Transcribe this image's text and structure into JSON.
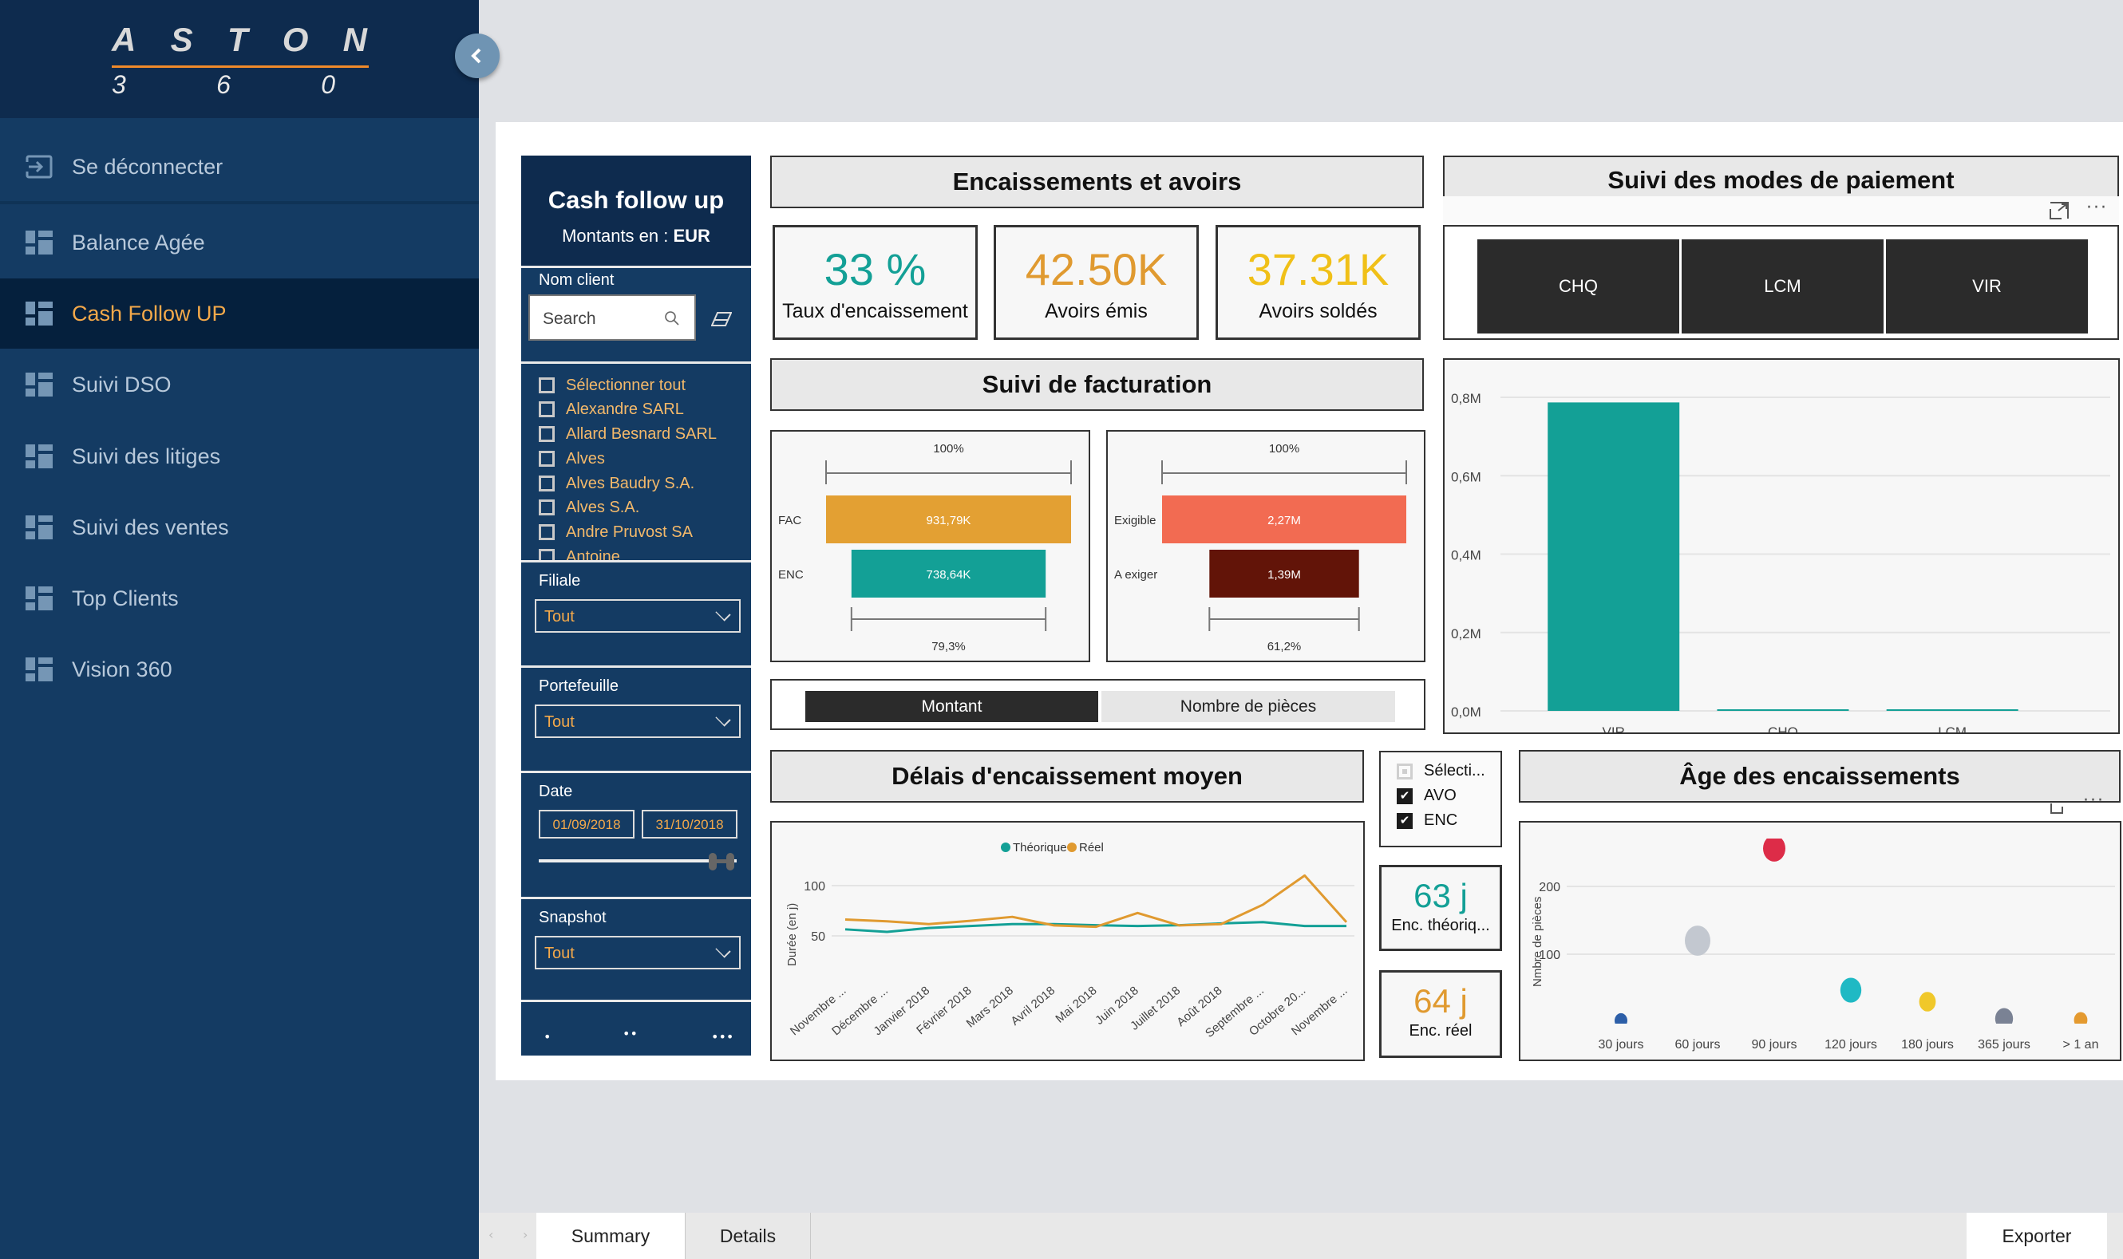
{
  "logo": {
    "letters": [
      "A",
      "S",
      "T",
      "O",
      "N"
    ],
    "numbers": [
      "3",
      "6",
      "0"
    ]
  },
  "sidebar": {
    "items": [
      {
        "label": "Se déconnecter",
        "icon": "logout-icon",
        "active": false
      },
      {
        "label": "Balance Agée",
        "icon": "dashboard-icon",
        "active": false
      },
      {
        "label": "Cash Follow UP",
        "icon": "dashboard-icon",
        "active": true
      },
      {
        "label": "Suivi DSO",
        "icon": "dashboard-icon",
        "active": false
      },
      {
        "label": "Suivi des litiges",
        "icon": "dashboard-icon",
        "active": false
      },
      {
        "label": "Suivi des ventes",
        "icon": "dashboard-icon",
        "active": false
      },
      {
        "label": "Top Clients",
        "icon": "dashboard-icon",
        "active": false
      },
      {
        "label": "Vision 360",
        "icon": "dashboard-icon",
        "active": false
      }
    ],
    "collapse_icon": "chevron-left-icon"
  },
  "slicer_panel": {
    "title": "Cash follow up",
    "subtitle_prefix": "Montants en : ",
    "currency": "EUR",
    "client": {
      "label": "Nom client",
      "search_placeholder": "Search",
      "items": [
        "Sélectionner tout",
        "Alexandre SARL",
        "Allard Besnard SARL",
        "Alves",
        "Alves Baudry S.A.",
        "Alves S.A.",
        "Andre Pruvost SA",
        "Antoine"
      ]
    },
    "filiale": {
      "label": "Filiale",
      "value": "Tout"
    },
    "portefeuille": {
      "label": "Portefeuille",
      "value": "Tout"
    },
    "date": {
      "label": "Date",
      "from": "01/09/2018",
      "to": "31/10/2018"
    },
    "snapshot": {
      "label": "Snapshot",
      "value": "Tout"
    },
    "pager": [
      "•",
      "••",
      "•••"
    ]
  },
  "encaissements": {
    "title": "Encaissements et avoirs",
    "kpis": [
      {
        "value": "33 %",
        "label": "Taux d'encaissement",
        "color": "#13a096"
      },
      {
        "value": "42.50K",
        "label": "Avoirs émis",
        "color": "#e09a30"
      },
      {
        "value": "37.31K",
        "label": "Avoirs soldés",
        "color": "#f0c018"
      }
    ]
  },
  "facturation": {
    "title": "Suivi de facturation",
    "toggle": {
      "options": [
        "Montant",
        "Nombre de pièces"
      ],
      "selected": "Montant"
    }
  },
  "modes": {
    "title": "Suivi des modes de paiement",
    "buttons": [
      "CHQ",
      "LCM",
      "VIR"
    ]
  },
  "delais": {
    "title": "Délais d'encaissement moyen"
  },
  "type_slicer": {
    "items": [
      {
        "label": "Sélecti...",
        "state": "partial"
      },
      {
        "label": "AVO",
        "state": "checked"
      },
      {
        "label": "ENC",
        "state": "checked"
      }
    ]
  },
  "cards": [
    {
      "value": "63 j",
      "label": "Enc. théoriq...",
      "color": "#13a096"
    },
    {
      "value": "64 j",
      "label": "Enc. réel",
      "color": "#e09a30"
    }
  ],
  "age": {
    "title": "Âge des encaissements"
  },
  "chart_data": [
    {
      "type": "funnel",
      "name": "facturation-funnel-fac-enc",
      "categories": [
        "FAC",
        "ENC"
      ],
      "values": [
        931.79,
        738.64
      ],
      "value_labels": [
        "931,79K",
        "738,64K"
      ],
      "top_label": "100%",
      "bottom_label": "79,3%",
      "colors": [
        "#e3a033",
        "#13a096"
      ]
    },
    {
      "type": "funnel",
      "name": "facturation-funnel-exigible",
      "categories": [
        "Exigible",
        "A exiger"
      ],
      "values": [
        2.27,
        1.39
      ],
      "value_labels": [
        "2,27M",
        "1,39M"
      ],
      "top_label": "100%",
      "bottom_label": "61,2%",
      "colors": [
        "#f26b52",
        "#621408"
      ]
    },
    {
      "type": "bar",
      "name": "modes-paiement-bar",
      "categories": [
        "VIR",
        "CHQ",
        "LCM"
      ],
      "values": [
        0.787,
        0.003,
        0.003
      ],
      "ylim": [
        0,
        0.8
      ],
      "yticks": [
        "0,0M",
        "0,2M",
        "0,4M",
        "0,6M",
        "0,8M"
      ],
      "ytick_values": [
        0,
        0.2,
        0.4,
        0.6,
        0.8
      ],
      "color": "#13a096",
      "grid": true
    },
    {
      "type": "line",
      "name": "delais-line",
      "x": [
        "Novembre ...",
        "Décembre ...",
        "Janvier 2018",
        "Février 2018",
        "Mars 2018",
        "Avril 2018",
        "Mai 2018",
        "Juin 2018",
        "Juillet 2018",
        "Août 2018",
        "Septembre ...",
        "Octobre 20...",
        "Novembre ..."
      ],
      "series": [
        {
          "name": "Théorique",
          "color": "#13a096",
          "values": [
            56.5,
            54,
            57.8,
            59.8,
            61.7,
            61.7,
            60.6,
            59.8,
            60.6,
            62.4,
            63.7,
            59.8,
            59.8
          ]
        },
        {
          "name": "Réel",
          "color": "#e09a30",
          "values": [
            66.3,
            64.5,
            61.7,
            65,
            68.9,
            60.4,
            59,
            72.8,
            60.4,
            61.7,
            81,
            110,
            63.7
          ]
        }
      ],
      "ylabel": "Durée (en j)",
      "yticks": [
        50,
        100
      ],
      "ylim": [
        0,
        125
      ],
      "legend": "top-center",
      "grid": true
    },
    {
      "type": "scatter",
      "name": "age-encaissements-scatter",
      "categories": [
        "30 jours",
        "60 jours",
        "90 jours",
        "120 jours",
        "180 jours",
        "365 jours",
        "> 1 an"
      ],
      "values": [
        2,
        120,
        256,
        47,
        30,
        5,
        3
      ],
      "colors": [
        "#2d5fa8",
        "#c3c8d0",
        "#dd2c48",
        "#1fb9c4",
        "#f0c82a",
        "#7a8294",
        "#e49a30"
      ],
      "sizes": [
        1,
        3,
        2.5,
        2.3,
        1.6,
        1.8,
        1.1
      ],
      "ylabel": "Nmbre de pièces",
      "yticks": [
        100,
        200
      ],
      "ylim": [
        0,
        240
      ],
      "grid": true
    }
  ],
  "visual_header_icons": [
    "focus-mode-icon",
    "more-options-icon"
  ],
  "tabs": {
    "items": [
      "Summary",
      "Details"
    ],
    "active": "Summary",
    "export_label": "Exporter"
  }
}
